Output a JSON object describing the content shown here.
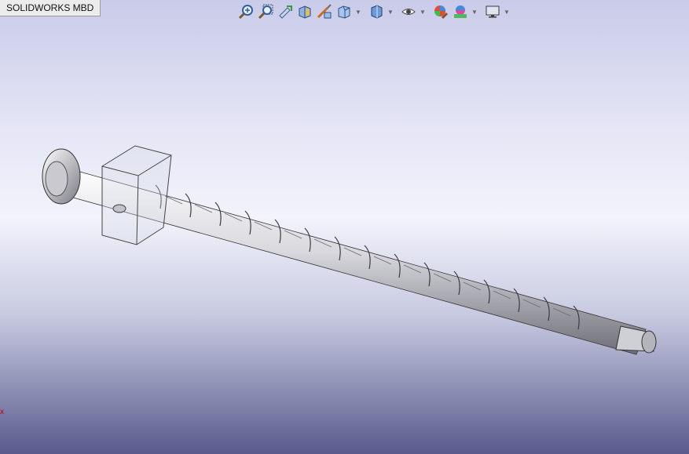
{
  "tab": {
    "label": "SOLIDWORKS MBD"
  },
  "toolbar": {
    "buttons": [
      {
        "name": "zoom-to-fit-icon"
      },
      {
        "name": "zoom-to-area-icon"
      },
      {
        "name": "previous-view-icon"
      },
      {
        "name": "section-view-icon"
      },
      {
        "name": "dynamic-annotation-views-icon"
      },
      {
        "name": "view-orientation-icon",
        "dropdown": true
      },
      {
        "name": "display-style-icon",
        "dropdown": true
      },
      {
        "name": "hide-show-items-icon",
        "dropdown": true
      },
      {
        "name": "edit-appearance-icon"
      },
      {
        "name": "apply-scene-icon",
        "dropdown": true
      },
      {
        "name": "view-settings-icon",
        "dropdown": true
      }
    ]
  },
  "colors": {
    "background_top": "#c9cbe9",
    "background_bottom": "#585b8c",
    "axis": "#c00000"
  },
  "axis_label": "x"
}
